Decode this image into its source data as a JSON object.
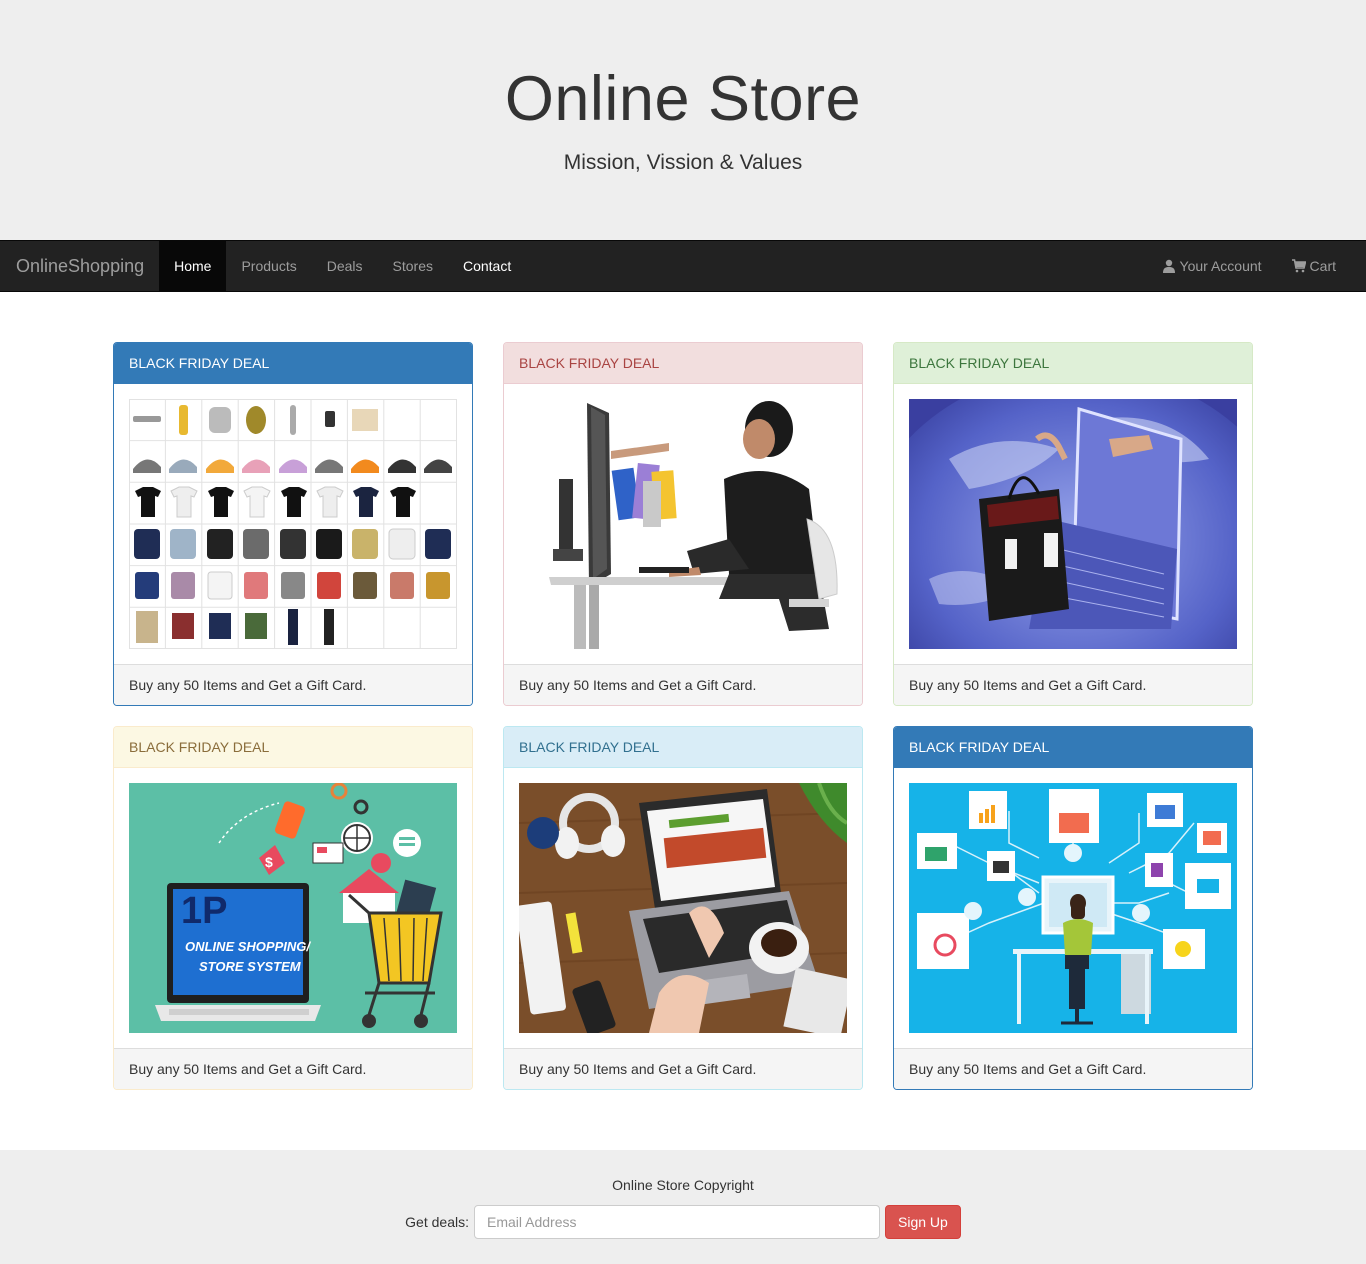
{
  "jumbotron": {
    "title": "Online Store",
    "subtitle": "Mission, Vission & Values"
  },
  "navbar": {
    "brand": "OnlineShopping",
    "items": [
      {
        "label": "Home"
      },
      {
        "label": "Products"
      },
      {
        "label": "Deals"
      },
      {
        "label": "Stores"
      },
      {
        "label": "Contact"
      }
    ],
    "account_label": "Your Account",
    "cart_label": "Cart"
  },
  "panels": [
    {
      "style": "primary",
      "heading": "BLACK FRIDAY DEAL",
      "image": "clothing-catalog-image",
      "footer": "Buy any 50 Items and Get a Gift Card."
    },
    {
      "style": "danger",
      "heading": "BLACK FRIDAY DEAL",
      "image": "woman-shopping-online-image",
      "footer": "Buy any 50 Items and Get a Gift Card."
    },
    {
      "style": "success",
      "heading": "BLACK FRIDAY DEAL",
      "image": "globe-laptop-shopping-bag-image",
      "footer": "Buy any 50 Items and Get a Gift Card."
    },
    {
      "style": "warning",
      "heading": "BLACK FRIDAY DEAL",
      "image": "online-shopping-store-system-image",
      "image_text": "ONLINE SHOPPING/ STORE SYSTEM",
      "footer": "Buy any 50 Items and Get a Gift Card."
    },
    {
      "style": "info",
      "heading": "BLACK FRIDAY DEAL",
      "image": "laptop-desk-workspace-image",
      "footer": "Buy any 50 Items and Get a Gift Card."
    },
    {
      "style": "primary",
      "heading": "BLACK FRIDAY DEAL",
      "image": "network-workstation-illustration-image",
      "footer": "Buy any 50 Items and Get a Gift Card."
    }
  ],
  "footer": {
    "copyright": "Online Store Copyright",
    "deals_label": "Get deals:",
    "email_placeholder": "Email Address",
    "signup_label": "Sign Up"
  },
  "colors": {
    "primary": "#337ab7",
    "danger_button": "#d9534f",
    "navbar_bg": "#222222",
    "jumbotron_bg": "#eeeeee"
  }
}
